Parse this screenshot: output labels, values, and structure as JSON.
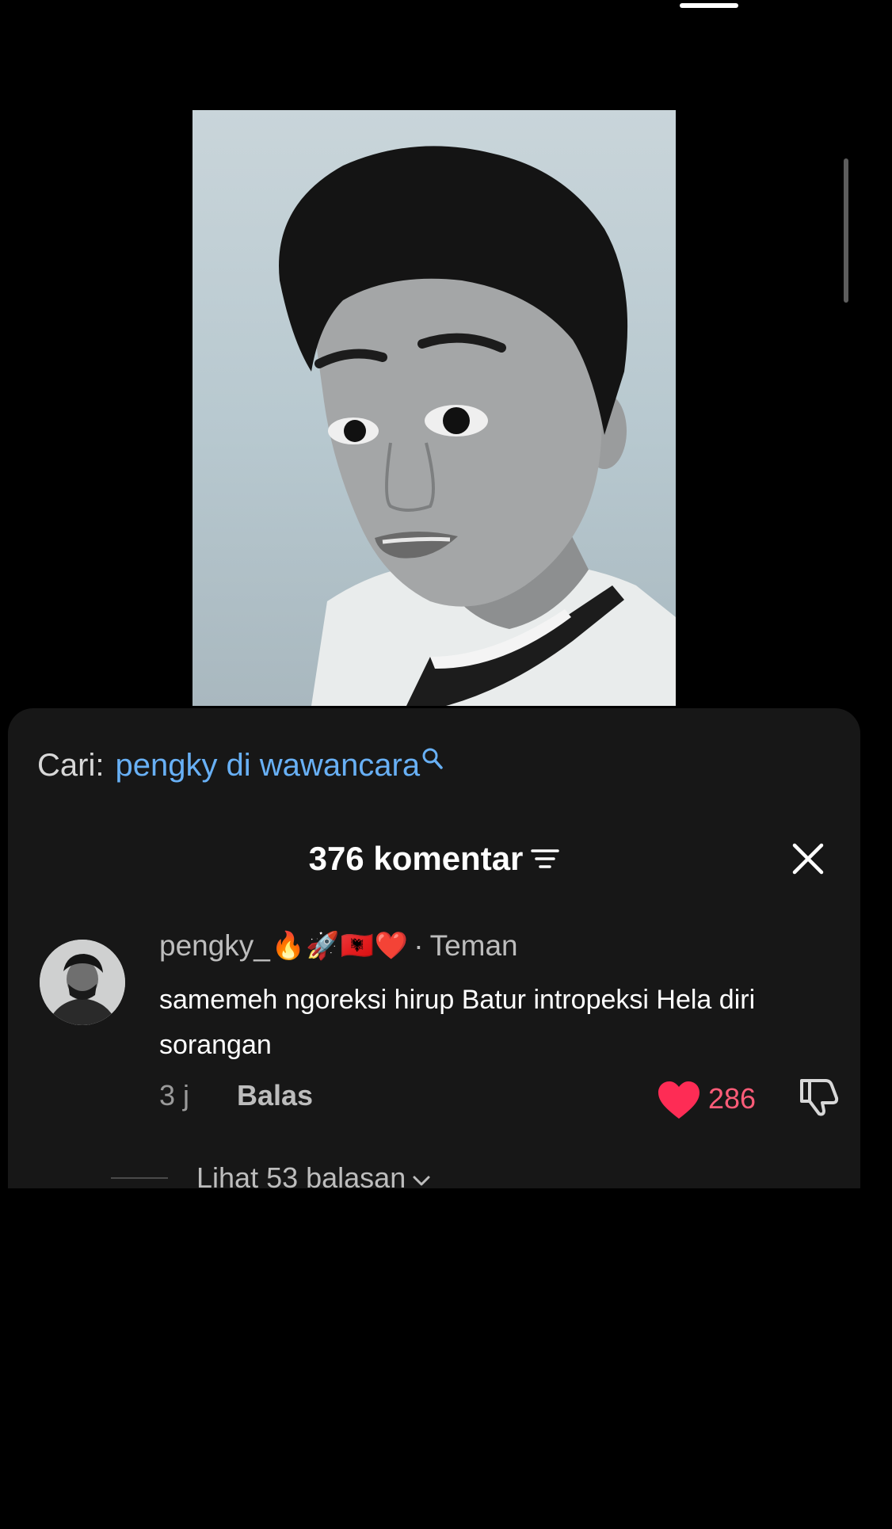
{
  "search": {
    "label": "Cari:",
    "query": "pengky di wawancara"
  },
  "comments_header": {
    "title": "376 komentar"
  },
  "comment": {
    "author": "pengky_",
    "author_badges": "🔥🚀🇦🇱❤️",
    "relation": "Teman",
    "text": "samemeh ngoreksi hirup Batur intropeksi Hela diri sorangan",
    "time": "3 j",
    "reply_label": "Balas",
    "likes": "286",
    "liked": true
  },
  "replies": {
    "label": "Lihat 53 balasan"
  },
  "colors": {
    "accent_blue": "#68b0f5",
    "like_red": "#fe2c55",
    "panel_bg": "#171717"
  },
  "icons": [
    "search-icon",
    "filter-icon",
    "close-icon",
    "heart-icon",
    "thumbs-down-icon",
    "chevron-down-icon"
  ]
}
